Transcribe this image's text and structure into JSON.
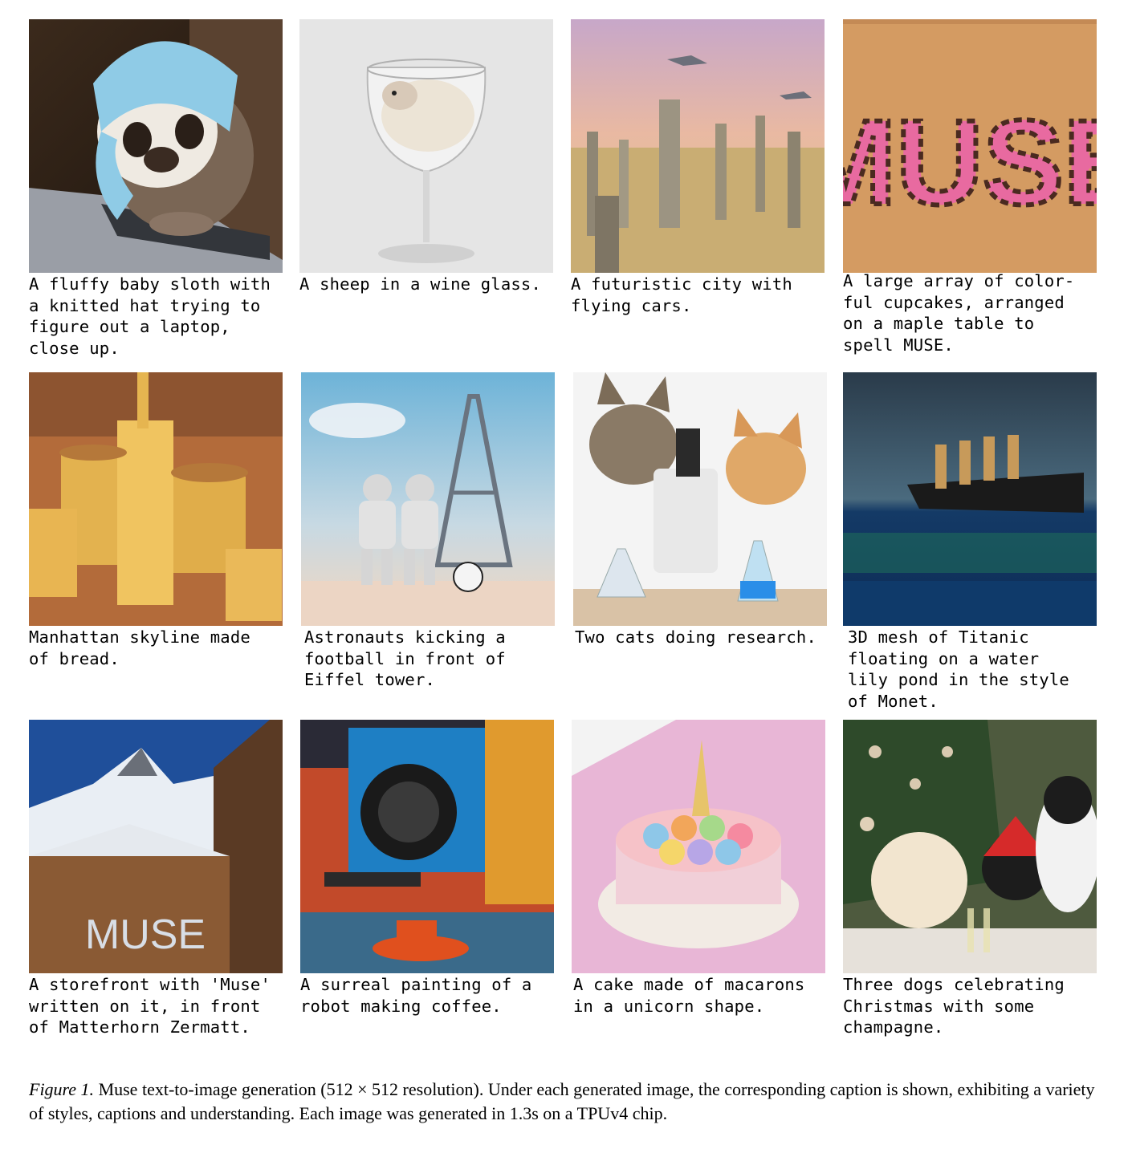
{
  "figure": {
    "label": "Figure 1.",
    "caption": " Muse text-to-image generation (512 × 512 resolution). Under each generated image, the corresponding caption is shown, exhibiting a variety of styles, captions and understanding. Each image was generated in 1.3s on a TPUv4 chip."
  },
  "tiles": [
    {
      "caption": "A fluffy baby sloth with\na knitted hat trying to\nfigure out a laptop,\nclose up."
    },
    {
      "caption": "A sheep in a wine glass."
    },
    {
      "caption": "A futuristic city with\nflying cars."
    },
    {
      "caption": "A large array of color-\nful cupcakes, arranged\non a maple table to\nspell MUSE.",
      "image_text": "MUSE"
    },
    {
      "caption": "Manhattan skyline made\nof bread."
    },
    {
      "caption": "Astronauts kicking a\nfootball in front of\nEiffel tower."
    },
    {
      "caption": "Two cats doing research."
    },
    {
      "caption": "3D mesh of Titanic\nfloating on a water\nlily pond in the style\nof Monet."
    },
    {
      "caption": "A storefront with 'Muse'\nwritten on it, in front\nof Matterhorn Zermatt.",
      "image_text": "MUSE"
    },
    {
      "caption": "A surreal painting of a\nrobot making coffee."
    },
    {
      "caption": "A cake made of macarons\nin a unicorn shape."
    },
    {
      "caption": "Three dogs celebrating\nChristmas with some\nchampagne."
    }
  ]
}
